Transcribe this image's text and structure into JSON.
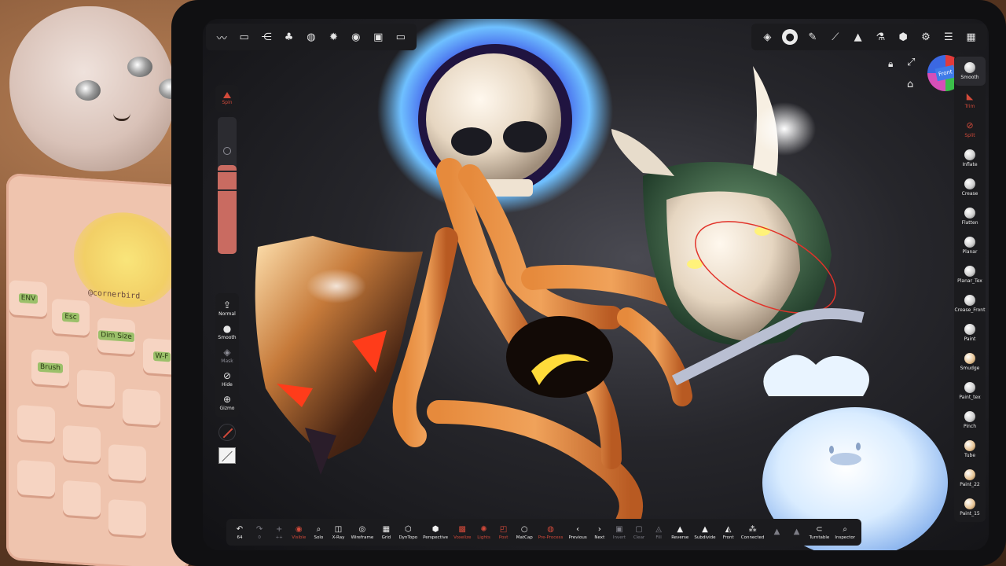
{
  "keypad": {
    "sticker_text": "@cornerbird_",
    "keys": [
      "ENV",
      "Esc",
      "Dim Size",
      "W-F",
      "Brush"
    ]
  },
  "top_left_toolbar": [
    "brush-stroke-icon",
    "folder-icon",
    "scene-graph-icon",
    "layers-icon",
    "material-icon",
    "gear-icon",
    "background-icon",
    "image-icon",
    "camera-icon"
  ],
  "top_right_toolbar": [
    "stack-icon",
    "brush-ball-icon",
    "pen-icon",
    "eyedropper-icon",
    "triangle-icon",
    "flask-icon",
    "cube-icon",
    "settings-gear-icon",
    "sliders-icon",
    "gallery-icon"
  ],
  "left_panel": {
    "spin_label": "Spin",
    "radius_level_percent": 65,
    "tools": [
      {
        "icon": "upload-icon",
        "label": "Normal"
      },
      {
        "icon": "smooth-ball-icon",
        "label": "Smooth"
      },
      {
        "icon": "mask-icon",
        "label": "Mask"
      },
      {
        "icon": "eye-slash-icon",
        "label": "Hide"
      },
      {
        "icon": "gizmo-icon",
        "label": "Gizmo"
      }
    ]
  },
  "viewport": {
    "view_cube_label": "Front"
  },
  "brushes": [
    {
      "label": "Smooth",
      "style": "white"
    },
    {
      "label": "Trim",
      "style": "red"
    },
    {
      "label": "Split",
      "style": "red"
    },
    {
      "label": "Inflate",
      "style": "white"
    },
    {
      "label": "Crease",
      "style": "white"
    },
    {
      "label": "Flatten",
      "style": "white"
    },
    {
      "label": "Planar",
      "style": "white"
    },
    {
      "label": "Planar_Tex",
      "style": "white"
    },
    {
      "label": "Crease_Front",
      "style": "white"
    },
    {
      "label": "Paint",
      "style": "white"
    },
    {
      "label": "Smudge",
      "style": "tan"
    },
    {
      "label": "Paint_tex",
      "style": "white"
    },
    {
      "label": "Pinch",
      "style": "white"
    },
    {
      "label": "Tube",
      "style": "tan"
    },
    {
      "label": "Paint_22",
      "style": "tan"
    },
    {
      "label": "Paint_15",
      "style": "tan"
    }
  ],
  "bottom_bar": [
    {
      "icon": "undo-icon",
      "label": "64",
      "state": "normal"
    },
    {
      "icon": "redo-icon",
      "label": "0",
      "state": "dim"
    },
    {
      "icon": "add-icon",
      "label": "++",
      "state": "dim"
    },
    {
      "icon": "visible-eye-icon",
      "label": "Visible",
      "state": "red"
    },
    {
      "icon": "solo-search-icon",
      "label": "Solo",
      "state": "normal"
    },
    {
      "icon": "xray-icon",
      "label": "X-Ray",
      "state": "normal"
    },
    {
      "icon": "wireframe-icon",
      "label": "Wireframe",
      "state": "normal"
    },
    {
      "icon": "grid-icon",
      "label": "Grid",
      "state": "normal"
    },
    {
      "icon": "dyntopo-icon",
      "label": "DynTopo",
      "state": "normal"
    },
    {
      "icon": "perspective-icon",
      "label": "Perspective",
      "state": "normal"
    },
    {
      "icon": "voxel-remesh-icon",
      "label": "Voxelize",
      "state": "red"
    },
    {
      "icon": "lights-icon",
      "label": "Lights",
      "state": "red"
    },
    {
      "icon": "post-process-icon",
      "label": "Post",
      "state": "red"
    },
    {
      "icon": "matcap-icon",
      "label": "MatCap",
      "state": "normal"
    },
    {
      "icon": "pbr-icon",
      "label": "Pre-Process",
      "state": "red"
    },
    {
      "icon": "previous-icon",
      "label": "Previous",
      "state": "normal"
    },
    {
      "icon": "next-icon",
      "label": "Next",
      "state": "normal"
    },
    {
      "icon": "invert-icon",
      "label": "Invert",
      "state": "dim"
    },
    {
      "icon": "clear-icon",
      "label": "Clear",
      "state": "dim"
    },
    {
      "icon": "mask-fill-icon",
      "label": "Fill",
      "state": "dim"
    },
    {
      "icon": "reverse-icon",
      "label": "Reverse",
      "state": "normal"
    },
    {
      "icon": "subdivide-icon",
      "label": "Subdivide",
      "state": "normal"
    },
    {
      "icon": "front-icon",
      "label": "Front",
      "state": "normal"
    },
    {
      "icon": "connected-icon",
      "label": "Connected",
      "state": "normal"
    },
    {
      "icon": "spacer-a-icon",
      "label": "",
      "state": "dim"
    },
    {
      "icon": "spacer-b-icon",
      "label": "",
      "state": "dim"
    },
    {
      "icon": "turntable-icon",
      "label": "Turntable",
      "state": "normal"
    },
    {
      "icon": "inspector-icon",
      "label": "Inspector",
      "state": "normal"
    }
  ],
  "colors": {
    "accent_red": "#d34a3a",
    "toolbar_bg": "#1b1b1e",
    "viewport_bg": "#2a2a30"
  }
}
